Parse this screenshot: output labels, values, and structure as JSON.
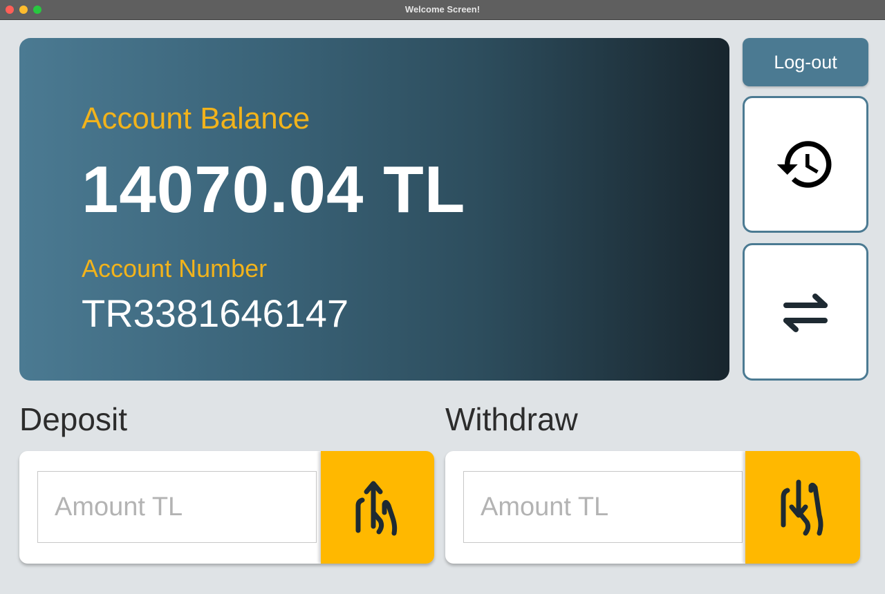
{
  "window": {
    "title": "Welcome Screen!"
  },
  "balance_card": {
    "balance_label": "Account Balance",
    "balance_value": "14070.04 TL",
    "account_label": "Account Number",
    "account_value": "TR3381646147"
  },
  "sidebar": {
    "logout_label": "Log-out",
    "history_icon": "history-icon",
    "transfer_icon": "transfer-arrows-icon"
  },
  "deposit": {
    "title": "Deposit",
    "placeholder": "Amount TL",
    "value": "",
    "icon": "deposit-hand-up-icon"
  },
  "withdraw": {
    "title": "Withdraw",
    "placeholder": "Amount TL",
    "value": "",
    "icon": "withdraw-hand-down-icon"
  },
  "colors": {
    "accent": "#4b7a92",
    "highlight": "#f2b31b",
    "action": "#ffb800",
    "background": "#dfe3e6"
  }
}
